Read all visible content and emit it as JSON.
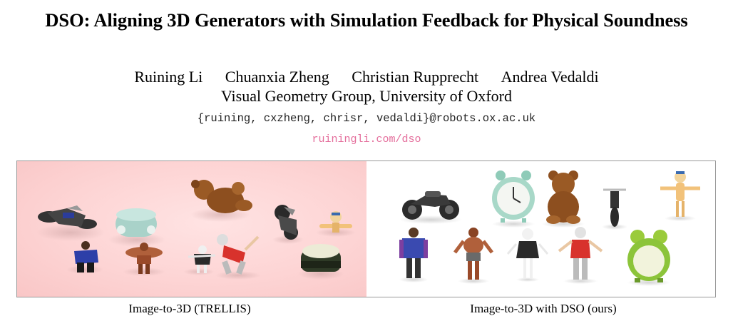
{
  "paper": {
    "title": "DSO: Aligning 3D Generators with Simulation Feedback for Physical Soundness",
    "authors": [
      "Ruining Li",
      "Chuanxia Zheng",
      "Christian Rupprecht",
      "Andrea Vedaldi"
    ],
    "affiliation": "Visual Geometry Group, University of Oxford",
    "emails": "{ruining, cxzheng, chrisr, vedaldi}@robots.ox.ac.uk",
    "project_link": "ruiningli.com/dso"
  },
  "figure": {
    "left_caption": "Image-to-3D (TRELLIS)",
    "right_caption": "Image-to-3D with DSO (ours)",
    "left_background": "#fdd4d4",
    "right_background": "#ffffff",
    "left_objects": [
      "motorcycle-toppled",
      "clock-toppled",
      "teddy-bear-toppled",
      "cartoon-dog-toppled",
      "person-jacket-fallen",
      "strongman-fallen",
      "doll-fallen",
      "cat-figure-fallen",
      "motorcycle-fallen",
      "alarm-clock-fallen"
    ],
    "right_objects": [
      "motorcycle-standing",
      "alarm-clock-standing",
      "teddy-bear-sitting",
      "motorcycle-upright",
      "cartoon-dog-standing",
      "person-jacket-standing",
      "strongman-standing",
      "doll-standing",
      "cat-figure-standing",
      "frog-alarm-clock-standing"
    ]
  }
}
